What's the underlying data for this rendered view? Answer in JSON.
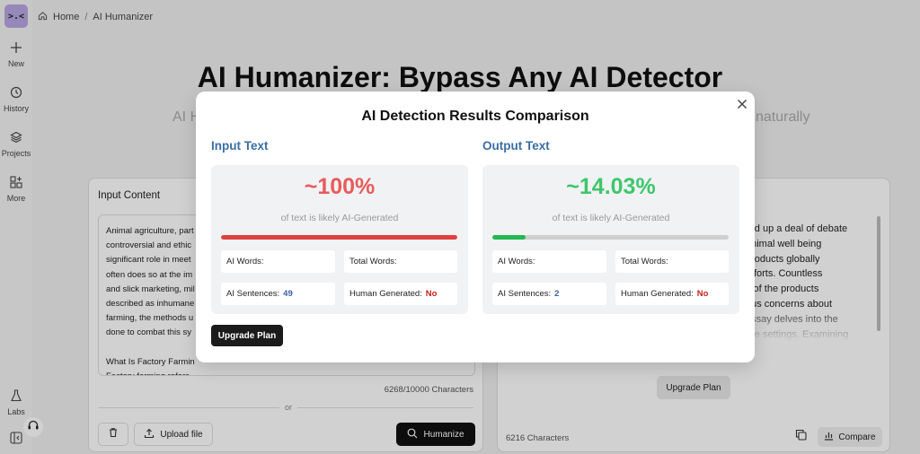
{
  "app": {
    "logo_text": ">.<"
  },
  "sidebar": {
    "items": [
      {
        "label": "New",
        "icon": "plus-icon"
      },
      {
        "label": "History",
        "icon": "history-icon"
      },
      {
        "label": "Projects",
        "icon": "layers-icon"
      },
      {
        "label": "More",
        "icon": "grid-plus-icon"
      },
      {
        "label": "Labs",
        "icon": "flask-icon"
      }
    ]
  },
  "breadcrumb": {
    "home": "Home",
    "current": "AI Humanizer"
  },
  "hero": {
    "title": "AI Humanizer: Bypass Any AI Detector",
    "subtitle_left_fragment": "AI H",
    "subtitle_right_fragment": "naturally"
  },
  "input_panel": {
    "title": "Input Content",
    "text": "Animal agriculture, part\ncontroversial and ethic\nsignificant role in meet\noften does so at the im\nand slick marketing, mil\ndescribed as inhumane\nfarming, the methods u\ndone to combat this sy\n\nWhat Is Factory Farmin\nFactory farming refers\nfood in highly controlled environments. The primary goal is to maximize output while",
    "char_count": "6268/10000 Characters",
    "or_label": "or",
    "upload_label": "Upload file",
    "humanize_label": "Humanize"
  },
  "output_panel": {
    "text": "red up a deal of debate\nanimal well being\nproducts globally\nefforts. Countless\ns of the products\nous concerns about\nessay delves into the\nure settings. Examining",
    "upgrade_label": "Upgrade Plan",
    "char_count": "6216 Characters",
    "compare_label": "Compare"
  },
  "modal": {
    "title": "AI Detection Results Comparison",
    "upgrade_label": "Upgrade Plan",
    "input": {
      "heading": "Input Text",
      "percent": "~100%",
      "percent_value": 1.0,
      "caption": "of text is likely AI-Generated",
      "ai_words_label": "AI Words:",
      "total_words_label": "Total Words:",
      "ai_sentences_label": "AI Sentences:",
      "ai_sentences_value": "49",
      "human_generated_label": "Human Generated:",
      "human_generated_value": "No"
    },
    "output": {
      "heading": "Output Text",
      "percent": "~14.03%",
      "percent_value": 0.1403,
      "caption": "of text is likely AI-Generated",
      "ai_words_label": "AI Words:",
      "total_words_label": "Total Words:",
      "ai_sentences_label": "AI Sentences:",
      "ai_sentences_value": "2",
      "human_generated_label": "Human Generated:",
      "human_generated_value": "No"
    }
  },
  "colors": {
    "input_accent": "#e85b5b",
    "output_accent": "#3dc76b",
    "heading_blue": "#3a6ea5",
    "bar_red": "#e0413f",
    "bar_green": "#22b950"
  }
}
